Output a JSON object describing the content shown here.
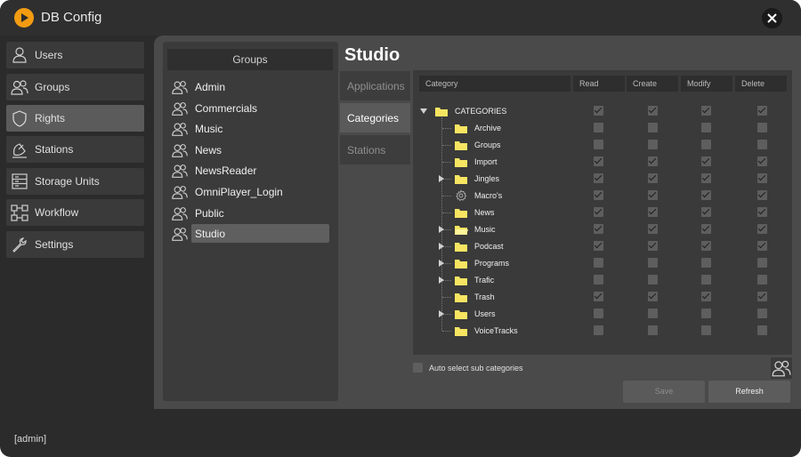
{
  "window": {
    "title": "DB Config",
    "status_user": "[admin]"
  },
  "nav": {
    "items": [
      {
        "label": "Users",
        "icon": "user-icon",
        "active": false
      },
      {
        "label": "Groups",
        "icon": "groups-icon",
        "active": false
      },
      {
        "label": "Rights",
        "icon": "shield-icon",
        "active": true
      },
      {
        "label": "Stations",
        "icon": "satellite-dish-icon",
        "active": false
      },
      {
        "label": "Storage Units",
        "icon": "storage-icon",
        "active": false
      },
      {
        "label": "Workflow",
        "icon": "workflow-icon",
        "active": false
      },
      {
        "label": "Settings",
        "icon": "wrench-icon",
        "active": false
      }
    ]
  },
  "groups": {
    "header": "Groups",
    "items": [
      "Admin",
      "Commercials",
      "Music",
      "News",
      "NewsReader",
      "OmniPlayer_Login",
      "Public",
      "Studio"
    ],
    "selected": "Studio"
  },
  "detail": {
    "title": "Studio",
    "tabs": [
      {
        "label": "Applications",
        "active": false
      },
      {
        "label": "Categories",
        "active": true
      },
      {
        "label": "Stations",
        "active": false
      }
    ],
    "columns": [
      "Category",
      "Read",
      "Create",
      "Modify",
      "Delete"
    ],
    "root": {
      "label": "CATEGORIES",
      "read": true,
      "create": true,
      "modify": true,
      "delete": true
    },
    "categories": [
      {
        "label": "Archive",
        "expandable": false,
        "icon": "folder-icon",
        "read": false,
        "create": false,
        "modify": false,
        "delete": false
      },
      {
        "label": "Groups",
        "expandable": false,
        "icon": "folder-icon",
        "read": false,
        "create": false,
        "modify": false,
        "delete": false
      },
      {
        "label": "Import",
        "expandable": false,
        "icon": "folder-icon",
        "read": true,
        "create": true,
        "modify": true,
        "delete": true
      },
      {
        "label": "Jingles",
        "expandable": true,
        "icon": "folder-icon",
        "read": true,
        "create": true,
        "modify": true,
        "delete": true
      },
      {
        "label": "Macro's",
        "expandable": false,
        "icon": "gear-icon",
        "read": true,
        "create": true,
        "modify": true,
        "delete": true
      },
      {
        "label": "News",
        "expandable": false,
        "icon": "folder-icon",
        "read": true,
        "create": true,
        "modify": true,
        "delete": true
      },
      {
        "label": "Music",
        "expandable": true,
        "icon": "folder-open-icon",
        "read": true,
        "create": true,
        "modify": true,
        "delete": true
      },
      {
        "label": "Podcast",
        "expandable": true,
        "icon": "folder-icon",
        "read": true,
        "create": true,
        "modify": true,
        "delete": true
      },
      {
        "label": "Programs",
        "expandable": true,
        "icon": "folder-icon",
        "read": false,
        "create": false,
        "modify": false,
        "delete": false
      },
      {
        "label": "Trafic",
        "expandable": true,
        "icon": "folder-icon",
        "read": false,
        "create": false,
        "modify": false,
        "delete": false
      },
      {
        "label": "Trash",
        "expandable": false,
        "icon": "folder-icon",
        "read": true,
        "create": true,
        "modify": true,
        "delete": true
      },
      {
        "label": "Users",
        "expandable": true,
        "icon": "folder-icon",
        "read": false,
        "create": false,
        "modify": false,
        "delete": false
      },
      {
        "label": "VoiceTracks",
        "expandable": false,
        "icon": "folder-icon",
        "read": false,
        "create": false,
        "modify": false,
        "delete": false
      }
    ],
    "auto_select_label": "Auto select sub categories",
    "auto_select_checked": false,
    "save_label": "Save",
    "refresh_label": "Refresh"
  },
  "colors": {
    "accent": "#f39c12",
    "folder": "#f7e562",
    "active_nav": "#5b5b5b"
  }
}
